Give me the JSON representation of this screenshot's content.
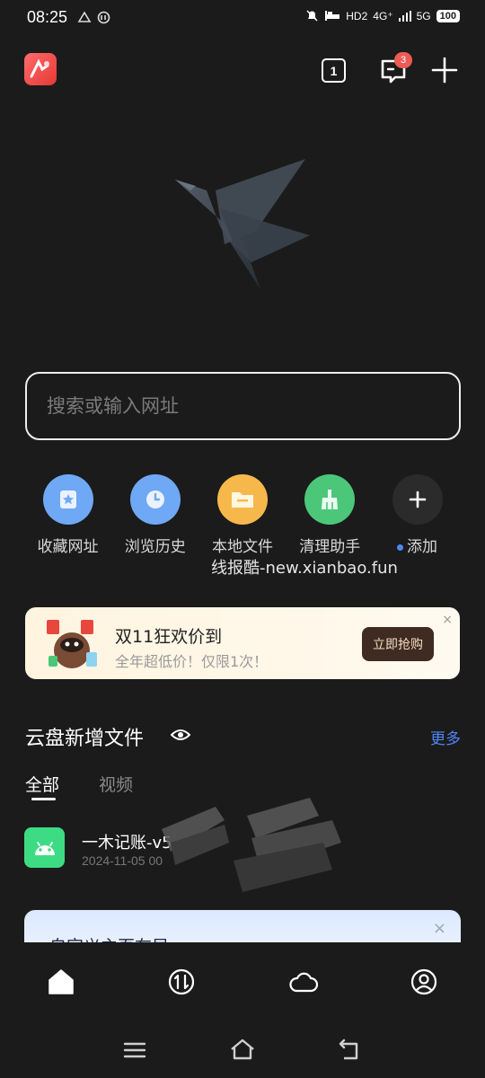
{
  "status_bar": {
    "time": "08:25",
    "network_label": "4G⁺",
    "network2_label": "5G",
    "hd_label": "HD2",
    "battery": "100"
  },
  "toolbar": {
    "tab_count": "1",
    "message_badge": "3"
  },
  "search": {
    "placeholder": "搜索或输入网址"
  },
  "shortcuts": [
    {
      "label": "收藏网址",
      "icon": "bookmark-star-icon",
      "color": "#6fa8f5"
    },
    {
      "label": "浏览历史",
      "icon": "clock-icon",
      "color": "#6fa8f5"
    },
    {
      "label": "本地文件",
      "icon": "folder-icon",
      "color": "#f7b84b"
    },
    {
      "label": "清理助手",
      "icon": "broom-icon",
      "color": "#4cc779"
    },
    {
      "label": "添加",
      "icon": "plus-icon",
      "color": "#2b2b2b"
    }
  ],
  "watermark": "线报酷-new.xianbao.fun",
  "promo": {
    "title": "双11狂欢价到",
    "subtitle": "全年超低价！仅限1次！",
    "button": "立即抢购",
    "close": "×"
  },
  "cloud": {
    "title": "云盘新增文件",
    "more": "更多",
    "tabs": [
      "全部",
      "视频"
    ],
    "file": {
      "name": "一木记账-v5",
      "date": "2024-11-05 00"
    }
  },
  "custom_card": {
    "title": "自定义主页布局",
    "close": "×"
  },
  "colors": {
    "background": "#1b1b1b",
    "accent": "#4f86f7",
    "badge": "#ec5b55"
  }
}
